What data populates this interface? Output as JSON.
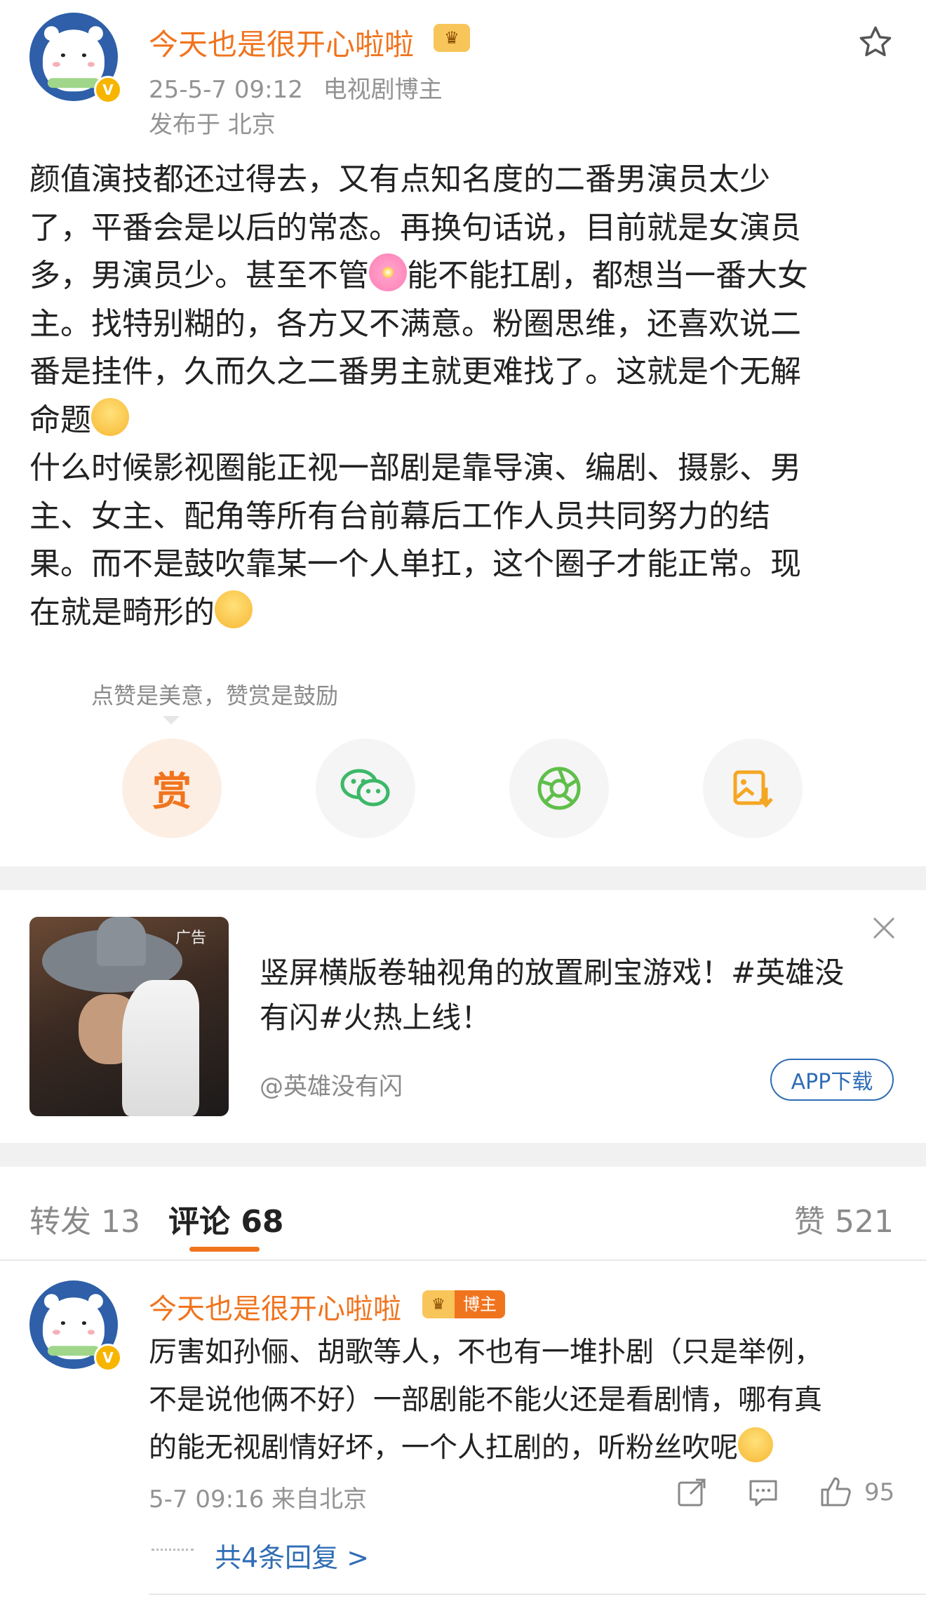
{
  "post": {
    "author": "今天也是很开心啦啦",
    "timestamp": "25-5-7 09:12",
    "role": "电视剧博主",
    "location": "发布于 北京",
    "body": {
      "line1": "颜值演技都还过得去，又有点知名度的二番男演员太少",
      "line2": "了，平番会是以后的常态。再换句话说，目前就是女演员",
      "line3a": "多，男演员少。甚至不管",
      "line3b": "能不能扛剧，都想当一番大女",
      "line4": "主。找特别糊的，各方又不满意。粉圈思维，还喜欢说二",
      "line5": "番是挂件，久而久之二番男主就更难找了。这就是个无解",
      "line6": "命题",
      "line7": "什么时候影视圈能正视一部剧是靠导演、编剧、摄影、男",
      "line8": "主、女主、配角等所有台前幕后工作人员共同努力的结",
      "line9": "果。而不是鼓吹靠某一个人单扛，这个圈子才能正常。现",
      "line10": "在就是畸形的"
    },
    "reward_tip": "点赞是美意，赞赏是鼓励",
    "reward_char": "赏"
  },
  "ad": {
    "title_line1": "竖屏横版卷轴视角的放置刷宝游戏！#英雄没",
    "title_line2": "有闪#火热上线！",
    "source": "@英雄没有闪",
    "download_label": "APP下载",
    "ad_tag": "广告"
  },
  "tabs": {
    "repost": "转发 13",
    "comments": "评论 68",
    "likes": "赞 521"
  },
  "comment": {
    "author": "今天也是很开心啦啦",
    "badge": "博主",
    "line1": "厉害如孙俪、胡歌等人，不也有一堆扑剧（只是举例，",
    "line2": "不是说他俩不好）一部剧能不能火还是看剧情，哪有真",
    "line3": "的能无视剧情好坏，一个人扛剧的，听粉丝吹呢",
    "meta": "5-7 09:16 来自北京",
    "like_count": "95",
    "replies": "共4条回复 >"
  },
  "colors": {
    "accent_orange": "#f0741e",
    "link_blue": "#2f6db5",
    "wechat_green": "#3cb868",
    "moments_green": "#5fbf4a",
    "save_orange": "#f5a623"
  }
}
